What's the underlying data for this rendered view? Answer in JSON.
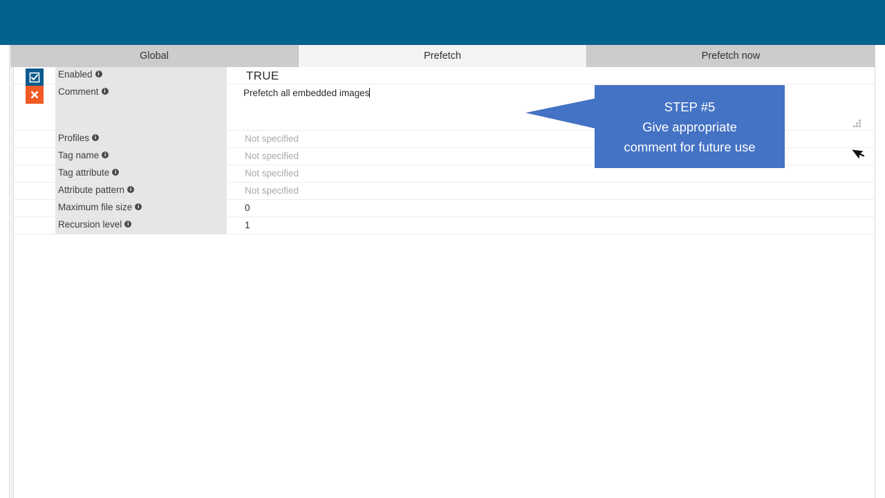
{
  "window": {
    "banner_color": "#03628f",
    "accent_color": "#4472c4"
  },
  "tabs": [
    {
      "label": "Global",
      "active": false
    },
    {
      "label": "Prefetch",
      "active": true
    },
    {
      "label": "Prefetch now",
      "active": false
    }
  ],
  "properties": [
    {
      "label": "Enabled",
      "info": "i",
      "value": "TRUE",
      "status": "checked",
      "placeholder": false
    },
    {
      "label": "Comment",
      "info": "i",
      "value": "Prefetch all embedded images",
      "status": "cross",
      "placeholder": false
    },
    {
      "label": "Profiles",
      "info": "i",
      "value": "Not specified",
      "status": "none",
      "placeholder": true
    },
    {
      "label": "Tag name",
      "info": "i",
      "value": "Not specified",
      "status": "none",
      "placeholder": true
    },
    {
      "label": "Tag attribute",
      "info": "i",
      "value": "Not specified",
      "status": "none",
      "placeholder": true
    },
    {
      "label": "Attribute pattern",
      "info": "i",
      "value": "Not specified",
      "status": "none",
      "placeholder": true
    },
    {
      "label": "Maximum file size",
      "info": "i",
      "value": "0",
      "status": "none",
      "placeholder": false
    },
    {
      "label": "Recursion level",
      "info": "i",
      "value": "1",
      "status": "none",
      "placeholder": false
    }
  ],
  "callout": {
    "line1": "STEP #5",
    "line2": "Give appropriate",
    "line3": "comment for future use",
    "color": "#4472c4"
  }
}
